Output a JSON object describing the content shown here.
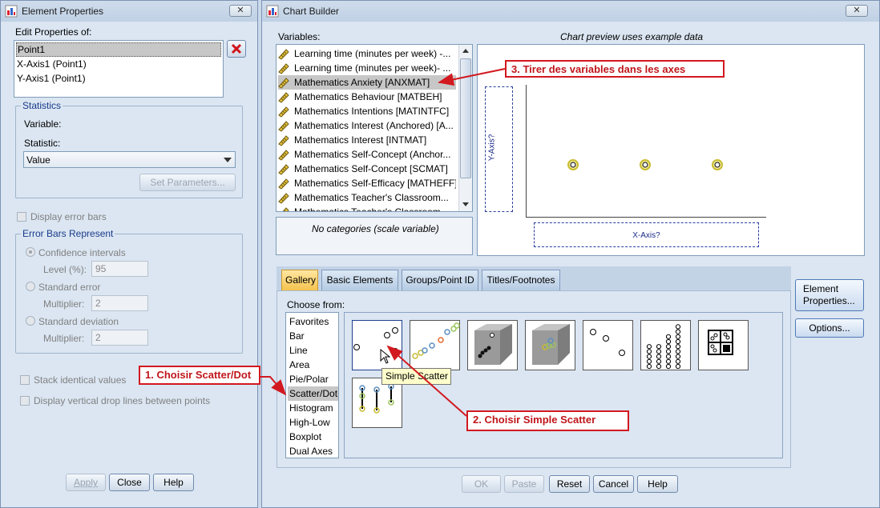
{
  "element_properties": {
    "title": "Element Properties",
    "close_symbol": "✕",
    "edit_label": "Edit Properties of:",
    "edit_items": [
      "Point1",
      "X-Axis1 (Point1)",
      "Y-Axis1 (Point1)"
    ],
    "statistics": {
      "group_title": "Statistics",
      "variable_label": "Variable:",
      "statistic_label": "Statistic:",
      "statistic_value": "Value",
      "set_parameters": "Set Parameters..."
    },
    "display_error_bars": "Display error bars",
    "error_bars": {
      "group_title": "Error Bars Represent",
      "confidence": "Confidence intervals",
      "level_label": "Level (%):",
      "level_value": "95",
      "standard_error": "Standard error",
      "multiplier_label": "Multiplier:",
      "multiplier_value": "2",
      "standard_deviation": "Standard deviation",
      "multiplier_label2": "Multiplier:",
      "multiplier_value2": "2"
    },
    "stack_identical": "Stack identical values",
    "drop_lines": "Display vertical drop lines between points",
    "buttons": {
      "apply": "Apply",
      "close": "Close",
      "help": "Help"
    }
  },
  "chart_builder": {
    "title": "Chart Builder",
    "close_symbol": "✕",
    "variables_label": "Variables:",
    "variables": [
      "Learning time (minutes per week) -...",
      "Learning time (minutes per week)- ...",
      "Mathematics Anxiety [ANXMAT]",
      "Mathematics Behaviour [MATBEH]",
      "Mathematics Intentions [MATINTFC]",
      "Mathematics Interest (Anchored) [A...",
      "Mathematics Interest [INTMAT]",
      "Mathematics Self-Concept (Anchor...",
      "Mathematics Self-Concept [SCMAT]",
      "Mathematics Self-Efficacy [MATHEFF]",
      "Mathematics Teacher's Classroom...",
      "Mathematics Teacher's Classroom..."
    ],
    "categories_text": "No categories (scale variable)",
    "preview_label": "Chart preview uses example data",
    "y_axis": "Y-Axis?",
    "x_axis": "X-Axis?",
    "tabs": [
      "Gallery",
      "Basic Elements",
      "Groups/Point ID",
      "Titles/Footnotes"
    ],
    "choose_from_label": "Choose from:",
    "chart_types": [
      "Favorites",
      "Bar",
      "Line",
      "Area",
      "Pie/Polar",
      "Scatter/Dot",
      "Histogram",
      "High-Low",
      "Boxplot",
      "Dual Axes"
    ],
    "tooltip": "Simple Scatter",
    "side_buttons": {
      "element_properties": "Element Properties...",
      "options": "Options..."
    },
    "buttons": {
      "ok": "OK",
      "paste": "Paste",
      "reset": "Reset",
      "cancel": "Cancel",
      "help": "Help"
    }
  },
  "annotations": {
    "step1": "1. Choisir Scatter/Dot",
    "step2": "2. Choisir Simple Scatter",
    "step3": "3. Tirer des variables dans les axes"
  },
  "colors": {
    "annotation_red": "#d2191f",
    "selected_row": "#c7c7c7",
    "gallery_tab": "#f5c34e",
    "tooltip_bg": "#ffffcc"
  }
}
